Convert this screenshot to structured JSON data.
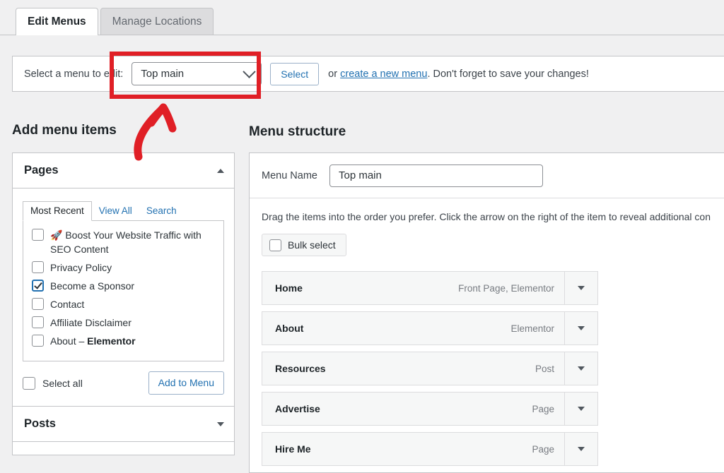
{
  "tabs": [
    {
      "label": "Edit Menus",
      "active": true
    },
    {
      "label": "Manage Locations",
      "active": false
    }
  ],
  "select_bar": {
    "label": "Select a menu to edit:",
    "selected_menu": "Top main",
    "dropdown_icon": "chevron-down-icon",
    "select_button": "Select",
    "or_text": "or",
    "create_link": "create a new menu",
    "reminder_text": ". Don't forget to save your changes!"
  },
  "add_menu_items": {
    "heading": "Add menu items",
    "pages_panel": {
      "title": "Pages",
      "collapse_icon": "triangle-up-icon",
      "subtabs": [
        {
          "label": "Most Recent",
          "active": true
        },
        {
          "label": "View All",
          "active": false
        },
        {
          "label": "Search",
          "active": false
        }
      ],
      "items": [
        {
          "emoji": "🚀",
          "label": "Boost Your Website Traffic with SEO Content",
          "checked": false,
          "bold_suffix": ""
        },
        {
          "emoji": "",
          "label": "Privacy Policy",
          "checked": false,
          "bold_suffix": ""
        },
        {
          "emoji": "",
          "label": "Become a Sponsor",
          "checked": true,
          "bold_suffix": ""
        },
        {
          "emoji": "",
          "label": "Contact",
          "checked": false,
          "bold_suffix": ""
        },
        {
          "emoji": "",
          "label": "Affiliate Disclaimer",
          "checked": false,
          "bold_suffix": ""
        },
        {
          "emoji": "",
          "label": "About – ",
          "checked": false,
          "bold_suffix": "Elementor"
        }
      ],
      "select_all_label": "Select all",
      "add_button": "Add to Menu"
    },
    "posts_panel": {
      "title": "Posts",
      "expand_icon": "triangle-down-icon"
    }
  },
  "menu_structure": {
    "heading": "Menu structure",
    "menu_name_label": "Menu Name",
    "menu_name_value": "Top main",
    "drag_hint": "Drag the items into the order you prefer. Click the arrow on the right of the item to reveal additional con",
    "bulk_select_label": "Bulk select",
    "items": [
      {
        "title": "Home",
        "type": "Front Page, Elementor",
        "toggle_icon": "triangle-down-icon"
      },
      {
        "title": "About",
        "type": "Elementor",
        "toggle_icon": "triangle-down-icon"
      },
      {
        "title": "Resources",
        "type": "Post",
        "toggle_icon": "triangle-down-icon"
      },
      {
        "title": "Advertise",
        "type": "Page",
        "toggle_icon": "triangle-down-icon"
      },
      {
        "title": "Hire Me",
        "type": "Page",
        "toggle_icon": "triangle-down-icon"
      }
    ]
  },
  "annotations": {
    "highlight_color": "#e01f26",
    "highlight_target": "menu-select-dropdown",
    "arrow_icon": "curved-arrow-up-icon"
  }
}
